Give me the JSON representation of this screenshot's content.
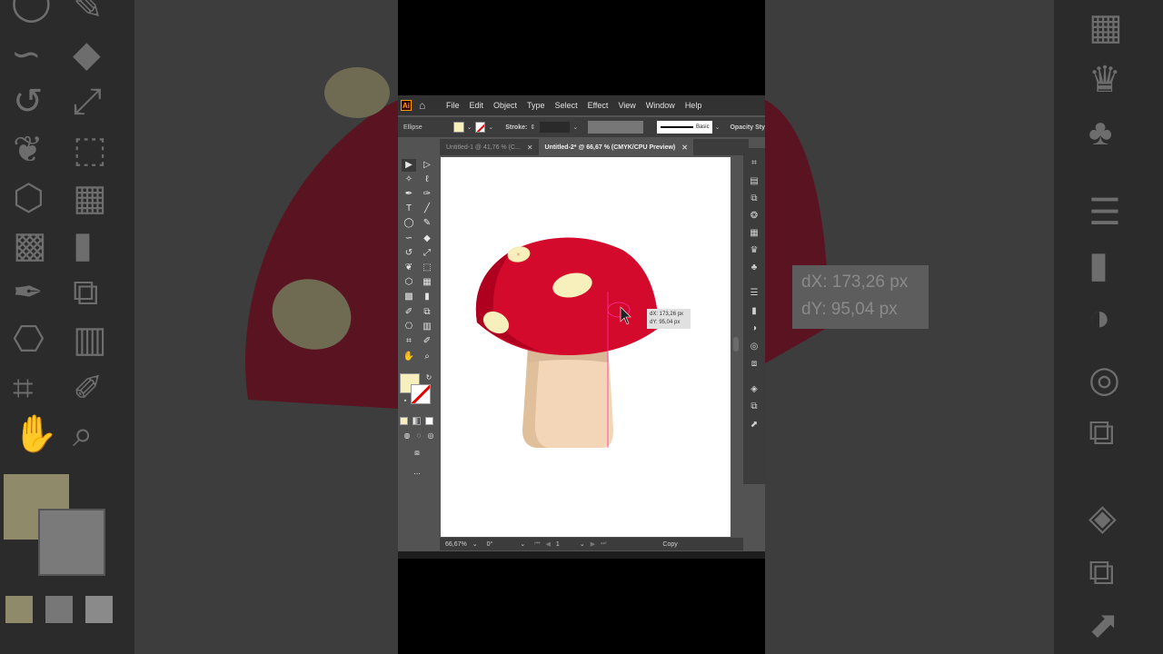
{
  "app": {
    "logo": "Ai",
    "home_icon": "home-icon"
  },
  "menu": [
    "File",
    "Edit",
    "Object",
    "Type",
    "Select",
    "Effect",
    "View",
    "Window",
    "Help"
  ],
  "control_bar": {
    "object_type": "Ellipse",
    "stroke_label": "Stroke:",
    "brush_label": "Basic",
    "opacity_label": "Opacity Sty",
    "fill_color": "#f7f0bd"
  },
  "tabs": [
    {
      "label": "Untitled-1 @ 41,76 % (C...",
      "active": false
    },
    {
      "label": "Untitled-2* @ 66,67 % (CMYK/CPU Preview)",
      "active": true
    }
  ],
  "status_bar": {
    "zoom": "66,67%",
    "rotation": "0°",
    "artboard": "1",
    "mode": "Copy"
  },
  "measure": {
    "dx": "dX: 173,26 px",
    "dy": "dY: 95,04 px"
  },
  "colors": {
    "cap_red": "#d40a2c",
    "cap_shadow": "#b00020",
    "spots": "#f7f0bd",
    "stem": "#f2d6b7",
    "stem_shadow": "#e0bf9b",
    "guide": "#ff2ea0"
  },
  "toolbar": {
    "more_label": "..."
  }
}
